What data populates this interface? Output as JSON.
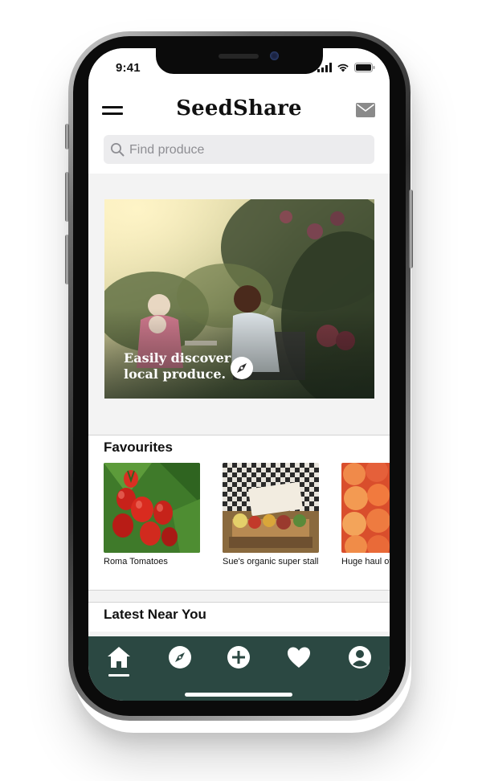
{
  "status_bar": {
    "time": "9:41"
  },
  "header": {
    "app_title": "SeedShare",
    "menu_icon": "hamburger-icon",
    "mail_icon": "mail-icon"
  },
  "search": {
    "placeholder": "Find produce",
    "value": ""
  },
  "hero": {
    "line1": "Easily discover",
    "line2": "local produce.",
    "icon": "compass-icon"
  },
  "favourites": {
    "title": "Favourites",
    "items": [
      {
        "label": "Roma Tomatoes"
      },
      {
        "label": "Sue's organic super stall"
      },
      {
        "label": "Huge haul of Nectarines"
      }
    ]
  },
  "latest": {
    "title": "Latest Near You"
  },
  "tabs": [
    {
      "name": "home",
      "icon": "home-icon",
      "active": true
    },
    {
      "name": "discover",
      "icon": "compass-icon",
      "active": false
    },
    {
      "name": "add",
      "icon": "plus-circle-icon",
      "active": false
    },
    {
      "name": "favourites",
      "icon": "heart-icon",
      "active": false
    },
    {
      "name": "profile",
      "icon": "user-icon",
      "active": false
    }
  ],
  "colors": {
    "tab_bar": "#2b4842",
    "background": "#f3f3f3",
    "search_bg": "#ececee"
  }
}
